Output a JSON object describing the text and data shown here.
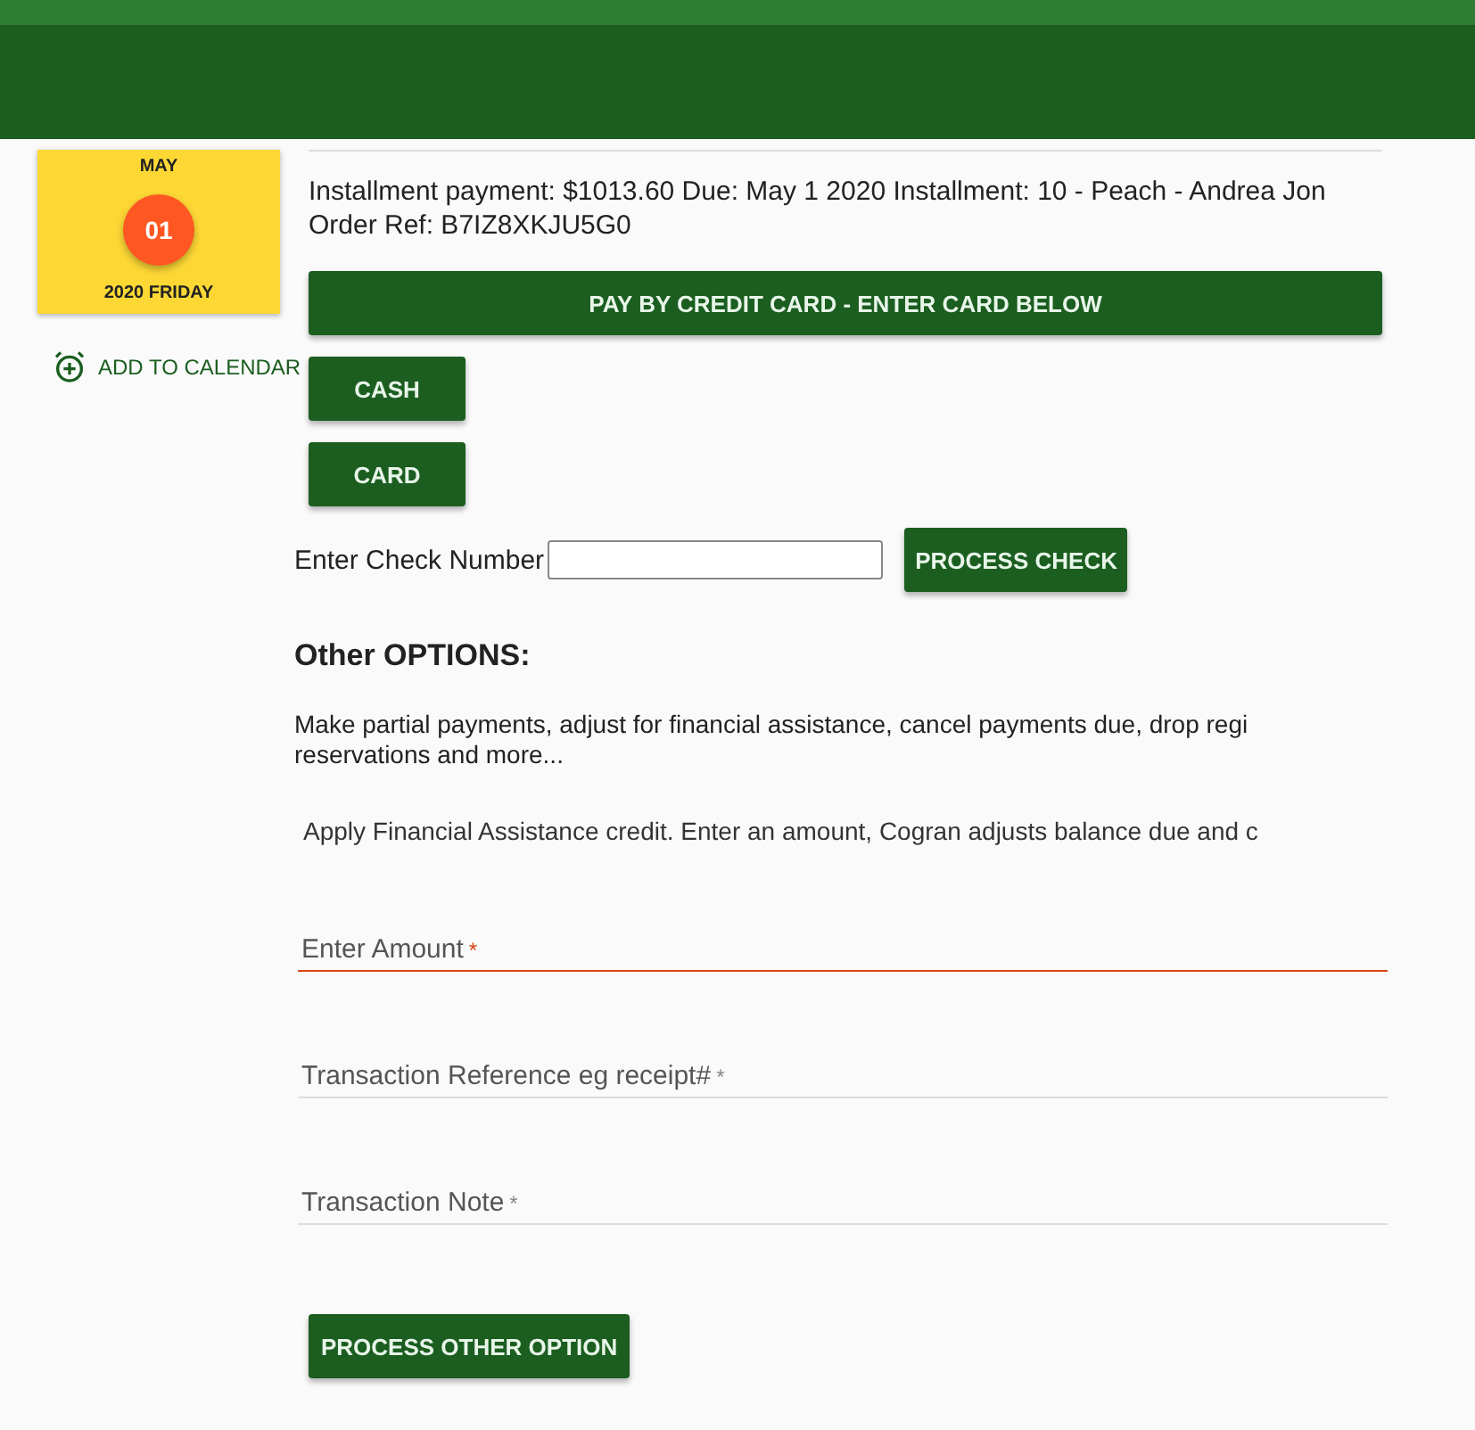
{
  "calendar": {
    "month": "MAY",
    "day": "01",
    "footer": "2020 FRIDAY",
    "add_link": "ADD TO CALENDAR"
  },
  "payment": {
    "description": "Installment payment: $1013.60 Due: May 1 2020 Installment: 10 - Peach - Andrea Jon",
    "order_ref": "Order Ref: B7IZ8XKJU5G0"
  },
  "credit_button": "PAY BY CREDIT CARD - ENTER CARD BELOW",
  "pay_buttons": [
    "CASH",
    "CARD"
  ],
  "check": {
    "label": "Enter Check Number",
    "button": "PROCESS CHECK"
  },
  "other": {
    "heading": "Other OPTIONS:",
    "description": "Make partial payments, adjust for financial assistance, cancel payments due, drop regi reservations and more...",
    "option_text": "Apply Financial Assistance credit. Enter an amount, Cogran adjusts balance due and c"
  },
  "fields": [
    {
      "placeholder": "Enter Amount",
      "required_mark": "*",
      "invalid": true
    },
    {
      "placeholder": "Transaction Reference eg receipt#",
      "required_mark": "*",
      "invalid": false
    },
    {
      "placeholder": "Transaction Note",
      "required_mark": "*",
      "invalid": false
    }
  ],
  "submit": "PROCESS OTHER OPTION"
}
